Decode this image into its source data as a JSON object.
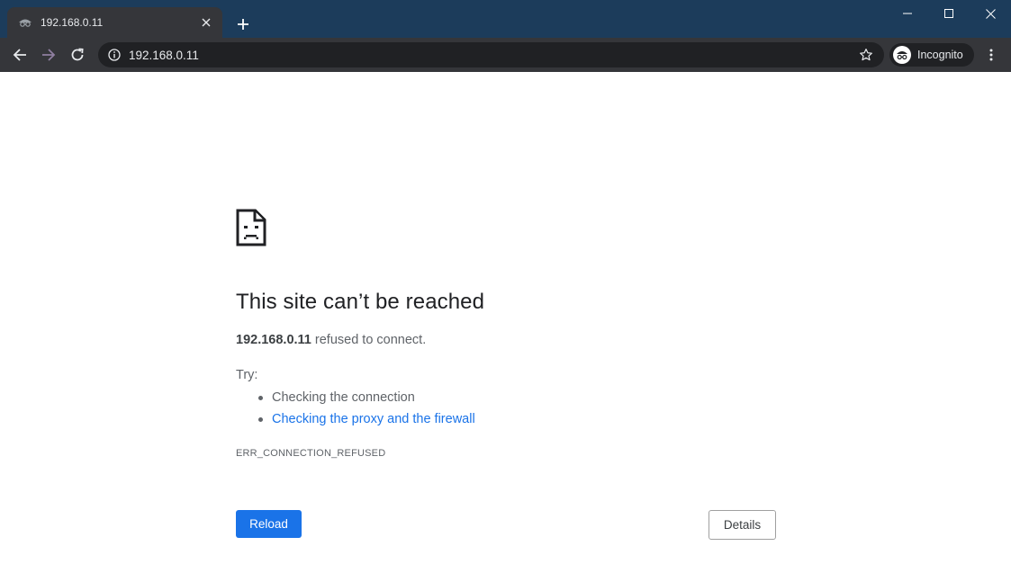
{
  "browser": {
    "tab": {
      "title": "192.168.0.11"
    },
    "address_bar": {
      "url": "192.168.0.11"
    },
    "profile": {
      "label": "Incognito"
    }
  },
  "page": {
    "title": "This site can’t be reached",
    "summary": {
      "host": "192.168.0.11",
      "message": " refused to connect."
    },
    "try_label": "Try:",
    "suggestions": [
      "Checking the connection",
      "Checking the proxy and the firewall"
    ],
    "error_code": "ERR_CONNECTION_REFUSED",
    "buttons": {
      "reload": "Reload",
      "details": "Details"
    }
  },
  "colors": {
    "titlebar": "#1c3c5b",
    "toolbar": "#35363a",
    "omnibox": "#202124",
    "primary_button": "#1a73e8",
    "link": "#1a73e8"
  },
  "icons": {
    "tab_favicon": "incognito-icon",
    "back": "arrow-left-icon",
    "forward": "arrow-right-icon",
    "reload": "reload-icon",
    "site_info": "info-icon",
    "bookmark": "star-icon",
    "menu": "kebab-menu-icon",
    "error": "sad-page-icon"
  }
}
